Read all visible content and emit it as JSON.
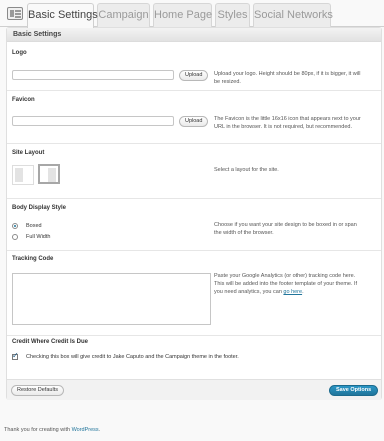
{
  "tabs": [
    {
      "label": "Basic Settings",
      "active": true
    },
    {
      "label": "Campaign",
      "active": false
    },
    {
      "label": "Home Page",
      "active": false
    },
    {
      "label": "Styles",
      "active": false
    },
    {
      "label": "Social Networks",
      "active": false
    }
  ],
  "panel": {
    "title": "Basic Settings"
  },
  "logo": {
    "title": "Logo",
    "value": "",
    "upload_label": "Upload",
    "description": "Upload your logo. Height should be 80px, if it is bigger, it will be resized."
  },
  "favicon": {
    "title": "Favicon",
    "value": "",
    "upload_label": "Upload",
    "description": "The Favicon is the little 16x16 icon that appears next to your URL in the browser. It is not required, but recommended."
  },
  "site_layout": {
    "title": "Site Layout",
    "description": "Select a layout for the site.",
    "selected_index": 1
  },
  "body_display": {
    "title": "Body Display Style",
    "options": [
      {
        "label": "Boxed",
        "checked": true
      },
      {
        "label": "Full Width",
        "checked": false
      }
    ],
    "description": "Choose if you want your site design to be boxed in or span the width of the browser."
  },
  "tracking": {
    "title": "Tracking Code",
    "value": "",
    "description": "Paste your Google Analytics (or other) tracking code here. This will be added into the footer template of your theme. If you need analytics, you can",
    "link_text": "go here"
  },
  "credit": {
    "title": "Credit Where Credit Is Due",
    "checked": true,
    "label": "Checking this box will give credit to Jake Caputo and the Campaign theme in the footer."
  },
  "actions": {
    "restore_label": "Restore Defaults",
    "save_label": "Save Options"
  },
  "footer": {
    "text": "Thank you for creating with",
    "link": "WordPress",
    "end": "."
  },
  "colors": {
    "accent": "#21759b",
    "background": "#f9f9f9"
  }
}
